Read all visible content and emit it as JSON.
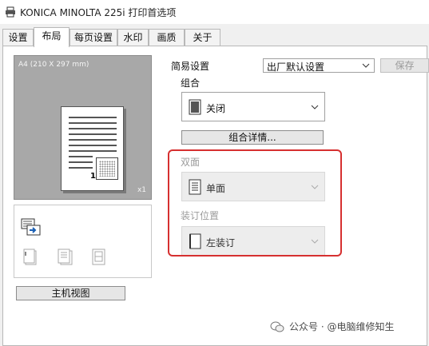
{
  "window": {
    "title": "KONICA MINOLTA 225i 打印首选项"
  },
  "tabs": [
    {
      "label": "设置"
    },
    {
      "label": "布局"
    },
    {
      "label": "每页设置"
    },
    {
      "label": "水印"
    },
    {
      "label": "画质"
    },
    {
      "label": "关于"
    }
  ],
  "preview": {
    "paper_size": "A4 (210 X 297 mm)",
    "copies": "x1",
    "page_number": "1"
  },
  "host_view_button": "主机视图",
  "easy_settings": {
    "label": "简易设置",
    "value": "出厂默认设置",
    "save_label": "保存"
  },
  "combination": {
    "label": "组合",
    "value": "关闭",
    "details_label": "组合详情..."
  },
  "duplex": {
    "label": "双面",
    "value": "单面"
  },
  "binding": {
    "label": "装订位置",
    "value": "左装订"
  },
  "watermark": {
    "text": "公众号 · @电脑维修知生"
  },
  "colors": {
    "highlight": "#d63030",
    "disabled_text": "#9b9b9b"
  }
}
